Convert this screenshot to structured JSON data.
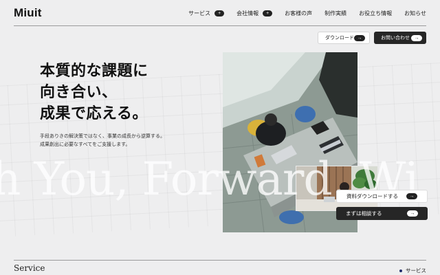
{
  "brand": {
    "logo": "Miuit"
  },
  "nav": {
    "items": [
      {
        "label": "サービス",
        "has_plus": true
      },
      {
        "label": "会社情報",
        "has_plus": true
      },
      {
        "label": "お客様の声",
        "has_plus": false
      },
      {
        "label": "制作実績",
        "has_plus": false
      },
      {
        "label": "お役立ち情報",
        "has_plus": false
      },
      {
        "label": "お知らせ",
        "has_plus": false
      }
    ],
    "plus_symbol": "+"
  },
  "header_buttons": {
    "download": "ダウンロード",
    "contact": "お問い合わせ",
    "arrow_symbol": "→"
  },
  "hero": {
    "title": "本質的な課題に\n向き合い、\n成果で応える。",
    "subtitle": "手段ありきの解決策ではなく、事業の成長から逆算する。\n成果創出に必要なすべてをご支援します。",
    "watermark": "h You, Forward. Wi"
  },
  "cta": {
    "download": "資料ダウンロードする",
    "consult": "まずは相談する"
  },
  "section": {
    "title": "Service",
    "link": "サービス"
  },
  "colors": {
    "background": "#eeeeef",
    "dark": "#262626",
    "accent_dot": "#1f2b6b"
  }
}
